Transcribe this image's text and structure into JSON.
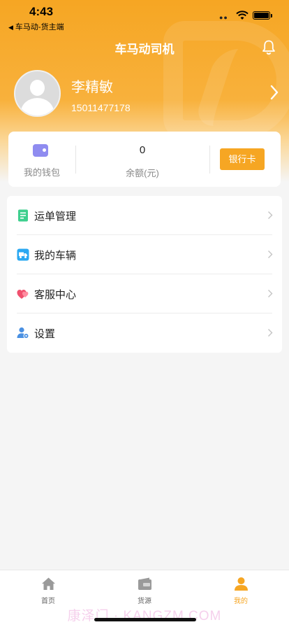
{
  "status_bar": {
    "time": "4:43",
    "back_app": "车马动-货主端",
    "back_arrow": "◀"
  },
  "header": {
    "title": "车马动司机",
    "bell_icon": "bell-icon"
  },
  "profile": {
    "name": "李精敏",
    "phone": "15011477178"
  },
  "wallet": {
    "wallet_label": "我的钱包",
    "balance_value": "0",
    "balance_label": "余额(元)",
    "bank_button": "银行卡"
  },
  "menu": {
    "items": [
      {
        "label": "运单管理",
        "icon": "waybill-icon",
        "color": "#3ecf8e"
      },
      {
        "label": "我的车辆",
        "icon": "truck-icon",
        "color": "#2aa8f2"
      },
      {
        "label": "客服中心",
        "icon": "heart-chat-icon",
        "color": "#f0506e"
      },
      {
        "label": "设置",
        "icon": "settings-user-icon",
        "color": "#4a90e2"
      }
    ]
  },
  "tabbar": {
    "tabs": [
      {
        "label": "首页",
        "icon": "home-icon",
        "active": false
      },
      {
        "label": "货源",
        "icon": "cargo-icon",
        "active": false
      },
      {
        "label": "我的",
        "icon": "user-icon",
        "active": true
      }
    ],
    "watermark": "康泽门 · KANGZM.COM"
  },
  "colors": {
    "accent": "#f6a623",
    "background": "#f5f5f5"
  }
}
